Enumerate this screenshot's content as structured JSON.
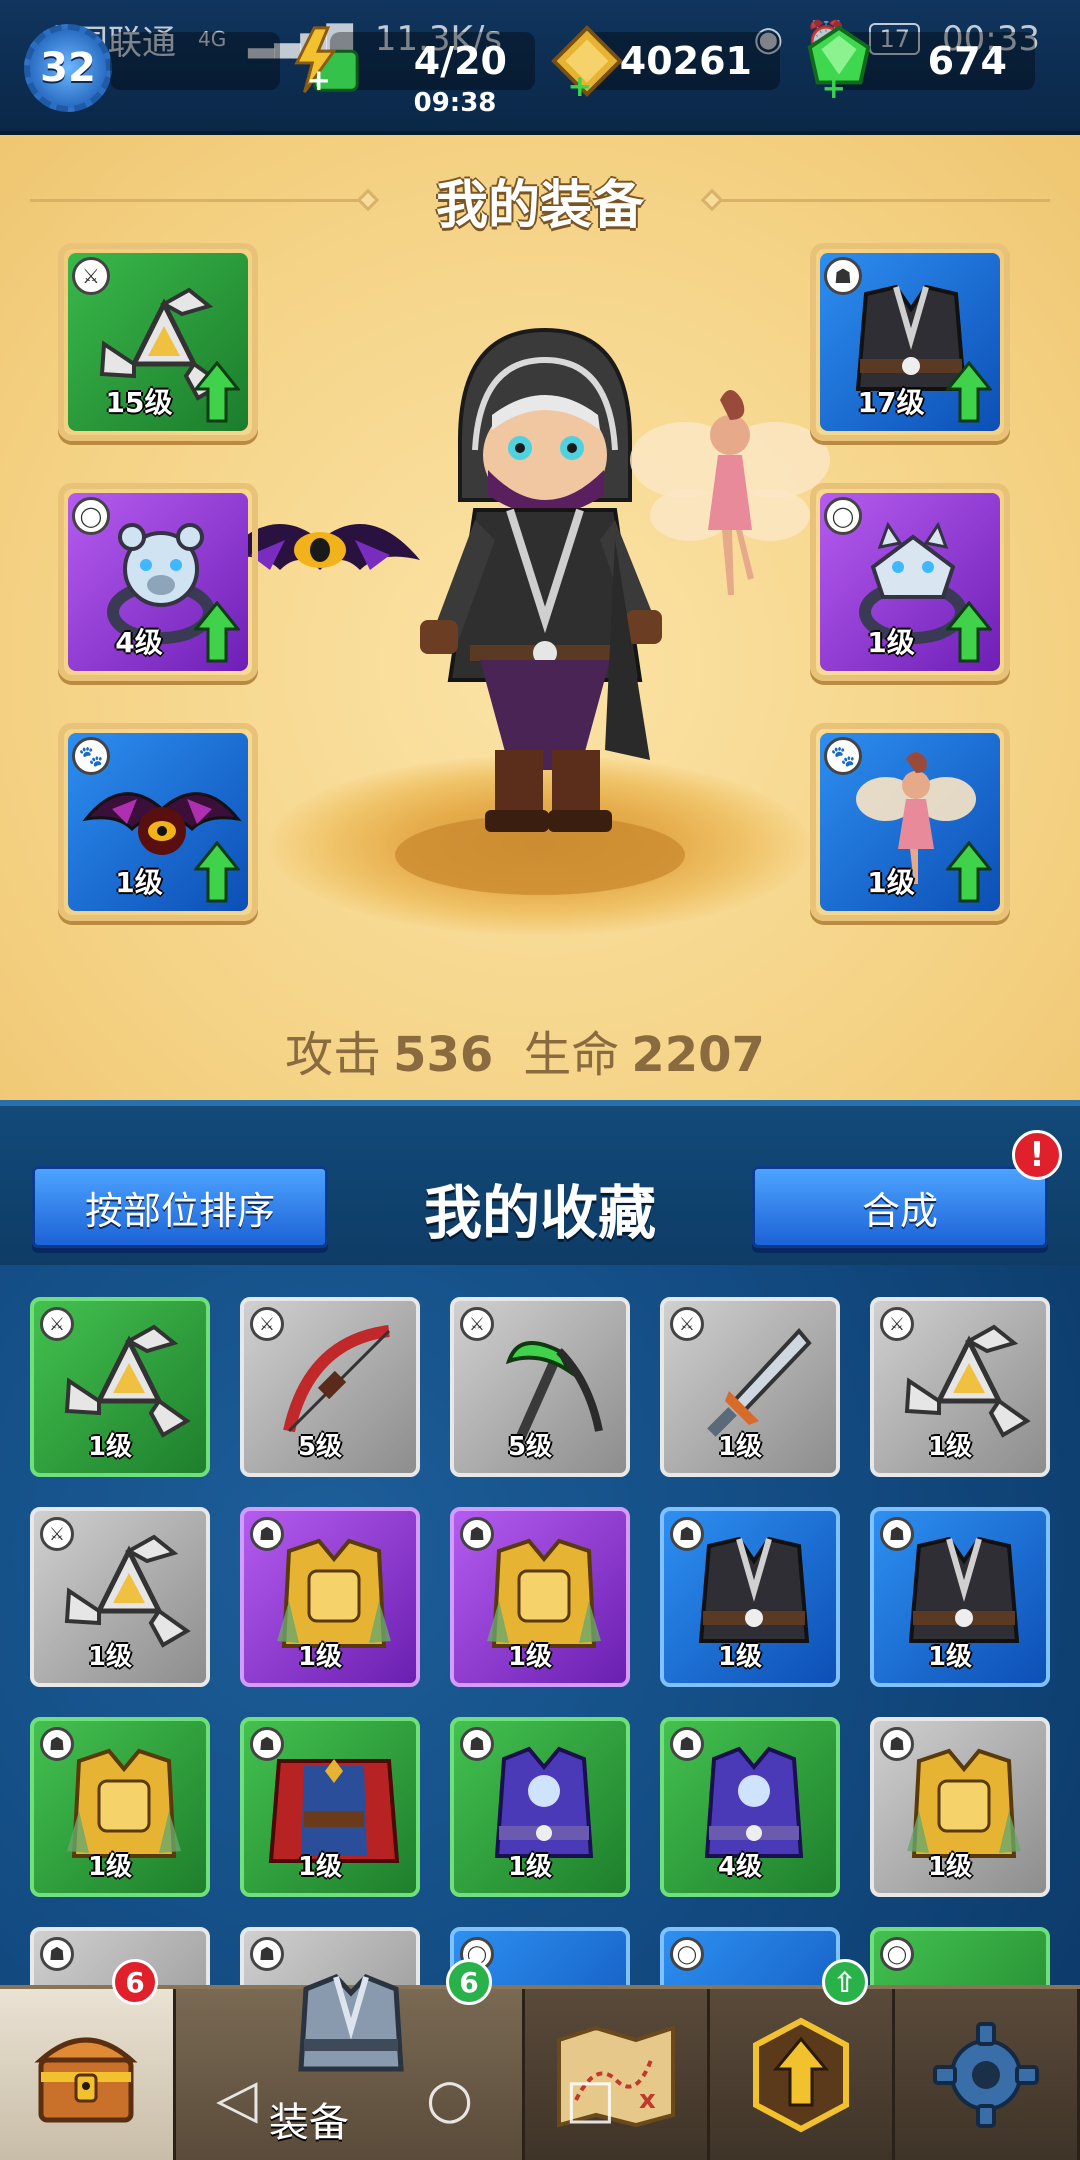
{
  "status_bar": {
    "carrier": "中国联通",
    "network": "4G",
    "speed": "11.3K/s",
    "battery": "17",
    "time": "00:33"
  },
  "currency": {
    "level": "32",
    "energy": "4/20",
    "energy_timer": "09:38",
    "gold": "40261",
    "gems": "674"
  },
  "equipment": {
    "title": "我的装备",
    "slots": [
      {
        "level": "15级",
        "category": "weapon",
        "color": "green"
      },
      {
        "level": "4级",
        "category": "ring",
        "color": "purple"
      },
      {
        "level": "1级",
        "category": "pet",
        "color": "blue"
      },
      {
        "level": "17级",
        "category": "armor",
        "color": "blue"
      },
      {
        "level": "1级",
        "category": "ring",
        "color": "purple"
      },
      {
        "level": "1级",
        "category": "pet",
        "color": "blue"
      }
    ],
    "stat_attack_label": "攻击",
    "stat_attack_value": "536",
    "stat_hp_label": "生命",
    "stat_hp_value": "2207"
  },
  "collection": {
    "sort_button": "按部位排序",
    "title": "我的收藏",
    "merge_button": "合成",
    "merge_alert": "!",
    "items": [
      {
        "level": "1级",
        "color": "green",
        "category": "weapon",
        "icon": "shuriken-icon"
      },
      {
        "level": "5级",
        "color": "gray",
        "category": "weapon",
        "icon": "bow-icon"
      },
      {
        "level": "5级",
        "color": "gray",
        "category": "weapon",
        "icon": "scythe-icon"
      },
      {
        "level": "1级",
        "color": "gray",
        "category": "weapon",
        "icon": "sword-icon"
      },
      {
        "level": "1级",
        "color": "gray",
        "category": "weapon",
        "icon": "shuriken-icon"
      },
      {
        "level": "1级",
        "color": "gray",
        "category": "weapon",
        "icon": "shuriken-icon"
      },
      {
        "level": "1级",
        "color": "purple",
        "category": "armor",
        "icon": "gold-armor-icon"
      },
      {
        "level": "1级",
        "color": "purple",
        "category": "armor",
        "icon": "gold-armor-icon"
      },
      {
        "level": "1级",
        "color": "blue",
        "category": "armor",
        "icon": "dark-vest-icon"
      },
      {
        "level": "1级",
        "color": "blue",
        "category": "armor",
        "icon": "dark-vest-icon"
      },
      {
        "level": "1级",
        "color": "green",
        "category": "armor",
        "icon": "gold-armor-icon"
      },
      {
        "level": "1级",
        "color": "green",
        "category": "armor",
        "icon": "red-cape-icon"
      },
      {
        "level": "1级",
        "color": "green",
        "category": "armor",
        "icon": "mage-robe-icon"
      },
      {
        "level": "4级",
        "color": "green",
        "category": "armor",
        "icon": "mage-robe-icon"
      },
      {
        "level": "1级",
        "color": "gray",
        "category": "armor",
        "icon": "gold-armor-icon"
      }
    ]
  },
  "nav": {
    "chest_badge": "6",
    "equip_badge": "6",
    "equip_label": "装备"
  },
  "colors": {
    "green": "#2ea83d",
    "blue": "#1a6fd8",
    "purple": "#9a3fe0",
    "gray": "#a8a8a8",
    "panel": "#f5d488"
  }
}
